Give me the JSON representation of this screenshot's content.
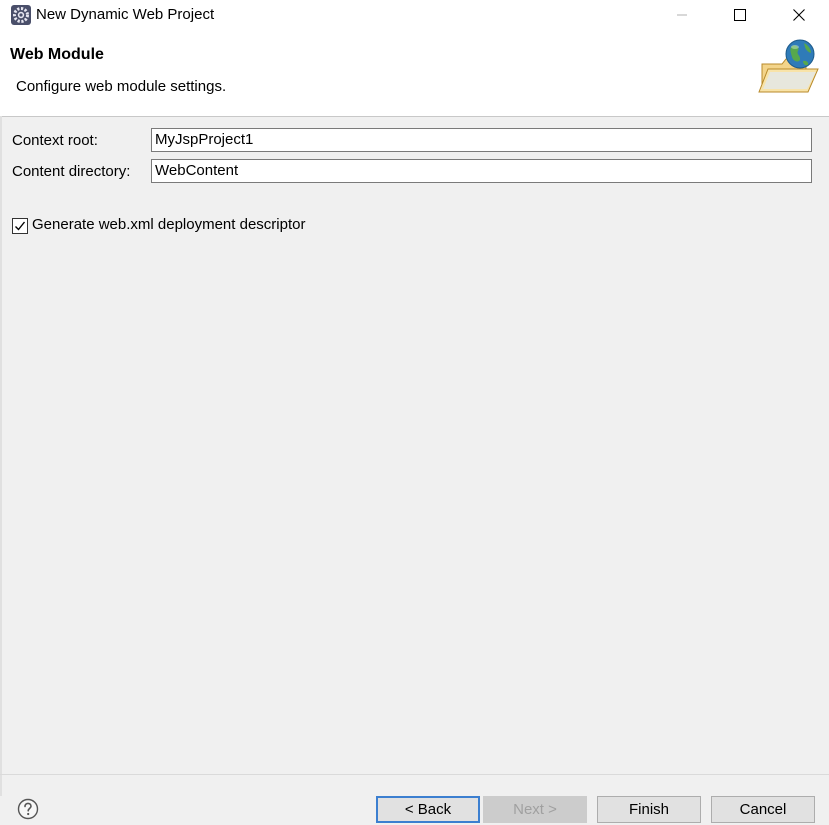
{
  "window": {
    "title": "New Dynamic Web Project",
    "icon": "eclipse-gear-icon",
    "controls": [
      "minimize-icon",
      "maximize-icon",
      "close-icon"
    ]
  },
  "header": {
    "title": "Web Module",
    "description": "Configure web module settings.",
    "banner_icon": "web-folder-globe-icon"
  },
  "form": {
    "context_root": {
      "label": "Context root:",
      "value": "MyJspProject1"
    },
    "content_directory": {
      "label": "Content directory:",
      "value": "WebContent"
    },
    "generate_descriptor": {
      "label": "Generate web.xml deployment descriptor",
      "checked": true
    }
  },
  "footer": {
    "help_icon": "help-icon",
    "back_label": "< Back",
    "next_label": "Next >",
    "finish_label": "Finish",
    "cancel_label": "Cancel"
  },
  "colors": {
    "accent": "#3c7fd0",
    "background": "#f0f0f0"
  }
}
